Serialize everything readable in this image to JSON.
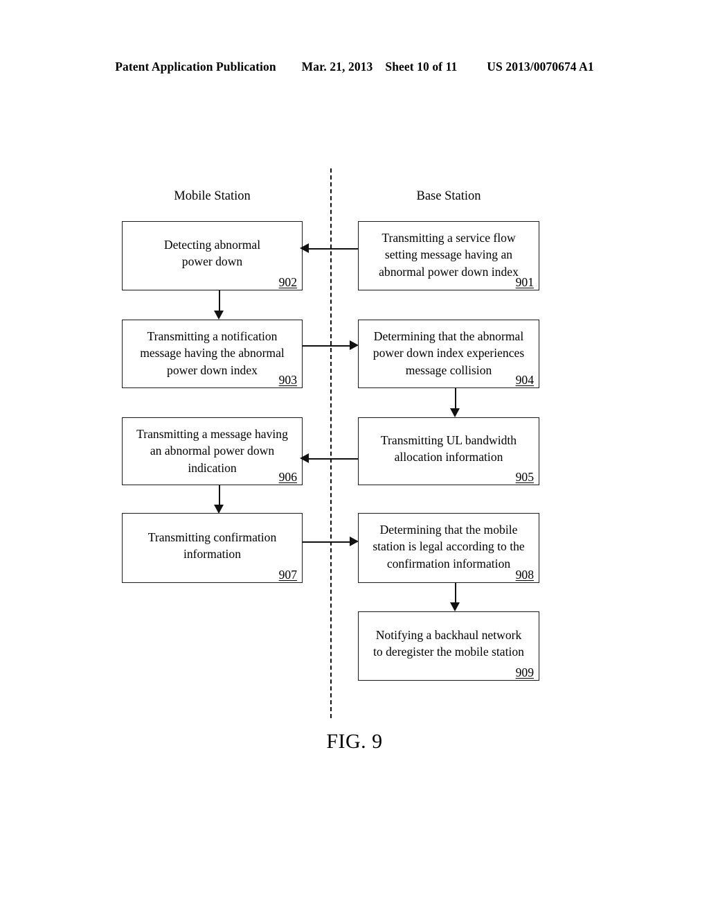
{
  "header": {
    "publication": "Patent Application Publication",
    "date": "Mar. 21, 2013",
    "sheet": "Sheet 10 of 11",
    "patent_number": "US 2013/0070674 A1"
  },
  "figure": {
    "caption": "FIG. 9",
    "lanes": [
      {
        "id": "mobile-station",
        "label": "Mobile Station"
      },
      {
        "id": "base-station",
        "label": "Base Station"
      }
    ],
    "steps": [
      {
        "id": "901",
        "lane": "base-station",
        "number": "901",
        "line1": "Transmitting a service flow",
        "line2": "setting message having an",
        "line3": "abnormal power down index"
      },
      {
        "id": "902",
        "lane": "mobile-station",
        "number": "902",
        "line1": "Detecting abnormal",
        "line2": "power down"
      },
      {
        "id": "903",
        "lane": "mobile-station",
        "number": "903",
        "line1": "Transmitting a notification",
        "line2": "message having the abnormal",
        "line3": "power down index"
      },
      {
        "id": "904",
        "lane": "base-station",
        "number": "904",
        "line1": "Determining that the abnormal",
        "line2": "power down index experiences",
        "line3": "message collision"
      },
      {
        "id": "905",
        "lane": "base-station",
        "number": "905",
        "line1": "Transmitting UL bandwidth",
        "line2": "allocation information"
      },
      {
        "id": "906",
        "lane": "mobile-station",
        "number": "906",
        "line1": "Transmitting a message having",
        "line2": "an abnormal power down",
        "line3": "indication"
      },
      {
        "id": "907",
        "lane": "mobile-station",
        "number": "907",
        "line1": "Transmitting confirmation",
        "line2": "information"
      },
      {
        "id": "908",
        "lane": "base-station",
        "number": "908",
        "line1": "Determining that the mobile",
        "line2": "station is legal according to the",
        "line3": "confirmation information"
      },
      {
        "id": "909",
        "lane": "base-station",
        "number": "909",
        "line1": "Notifying a backhaul network",
        "line2": "to deregister the mobile station"
      }
    ]
  }
}
